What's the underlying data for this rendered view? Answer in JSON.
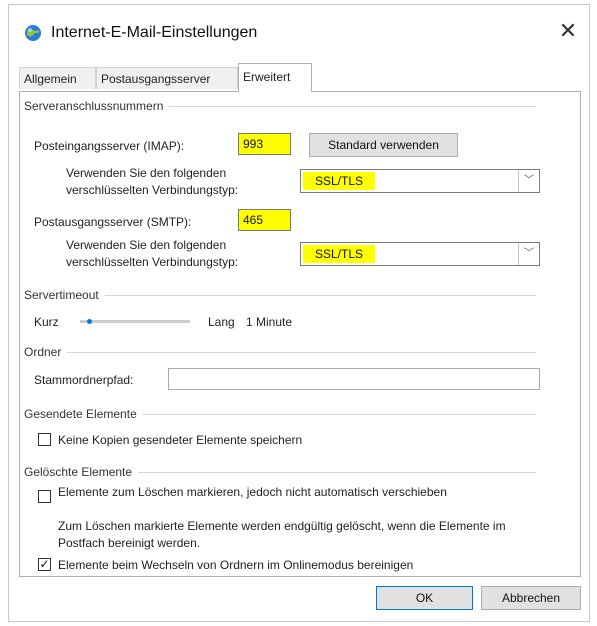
{
  "window": {
    "title": "Internet-E-Mail-Einstellungen",
    "icon": "outlook-globe-icon",
    "close_glyph": "✕"
  },
  "tabs": [
    {
      "label": "Allgemein",
      "active": false
    },
    {
      "label": "Postausgangsserver",
      "active": false
    },
    {
      "label": "Erweitert",
      "active": true
    }
  ],
  "server_ports": {
    "group_label": "Serveranschlussnummern",
    "imap_label": "Posteingangsserver (IMAP):",
    "imap_value": "993",
    "standard_button": "Standard verwenden",
    "imap_encryption_label": "Verwenden Sie den folgenden verschlüsselten Verbindungstyp:",
    "imap_encryption_value": "SSL/TLS",
    "smtp_label": "Postausgangsserver (SMTP):",
    "smtp_value": "465",
    "smtp_encryption_label": "Verwenden Sie den folgenden verschlüsselten Verbindungstyp:",
    "smtp_encryption_value": "SSL/TLS"
  },
  "timeout": {
    "group_label": "Servertimeout",
    "short_label": "Kurz",
    "long_label": "Lang",
    "value_label": "1 Minute",
    "slider_fraction": 0.08
  },
  "folder": {
    "group_label": "Ordner",
    "root_path_label": "Stammordnerpfad:",
    "root_path_value": ""
  },
  "sent_items": {
    "group_label": "Gesendete Elemente",
    "no_copies_label": "Keine Kopien gesendeter Elemente speichern",
    "no_copies_checked": false
  },
  "deleted_items": {
    "group_label": "Gelöschte Elemente",
    "mark_for_deletion_label": "Elemente zum Löschen markieren, jedoch nicht automatisch verschieben",
    "mark_for_deletion_checked": false,
    "info_text": "Zum Löschen markierte Elemente werden endgültig gelöscht, wenn die Elemente im Postfach bereinigt werden.",
    "purge_label": "Elemente beim Wechseln von Ordnern im Onlinemodus bereinigen",
    "purge_checked": true
  },
  "footer": {
    "ok_label": "OK",
    "cancel_label": "Abbrechen"
  },
  "colors": {
    "highlight": "#ffff00",
    "accent": "#0078d7"
  }
}
